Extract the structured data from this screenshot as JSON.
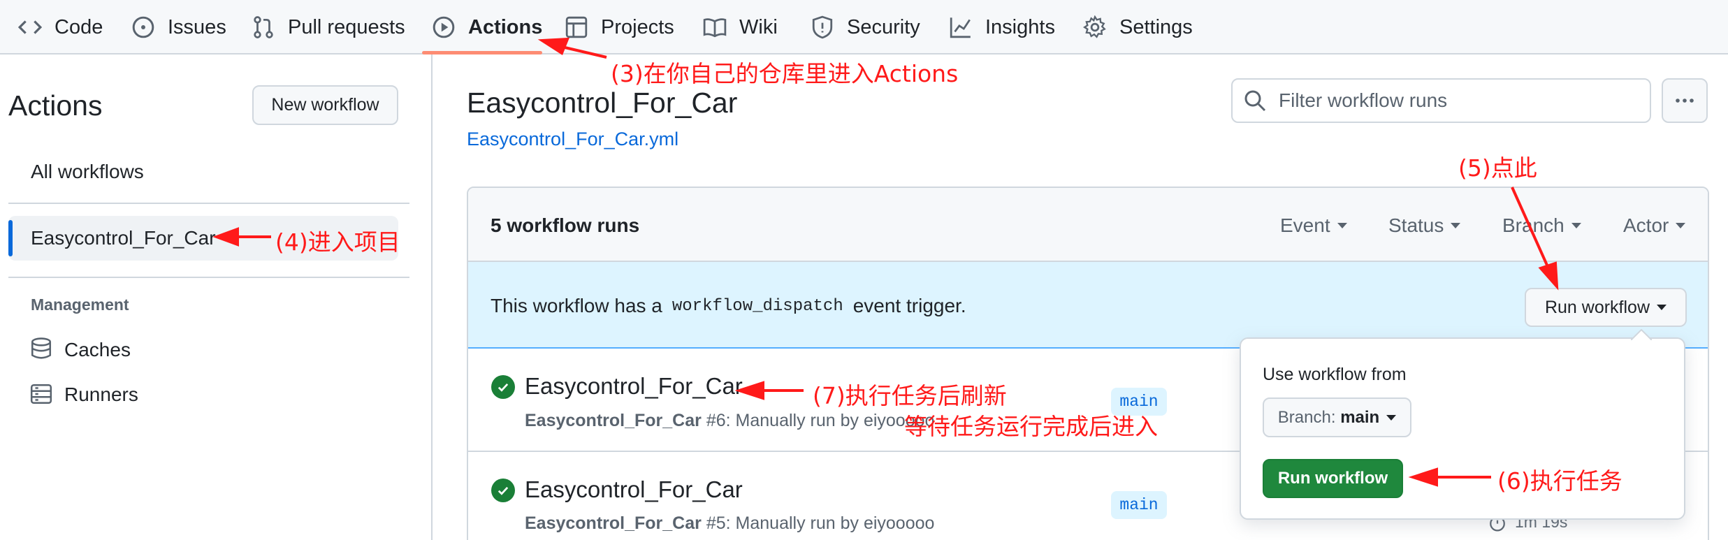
{
  "nav": {
    "tabs": [
      {
        "label": "Code",
        "icon": "code-icon"
      },
      {
        "label": "Issues",
        "icon": "issue-icon"
      },
      {
        "label": "Pull requests",
        "icon": "pull-request-icon"
      },
      {
        "label": "Actions",
        "icon": "play-icon",
        "active": true
      },
      {
        "label": "Projects",
        "icon": "table-icon"
      },
      {
        "label": "Wiki",
        "icon": "book-icon"
      },
      {
        "label": "Security",
        "icon": "shield-icon"
      },
      {
        "label": "Insights",
        "icon": "graph-icon"
      },
      {
        "label": "Settings",
        "icon": "gear-icon"
      }
    ]
  },
  "sidebar": {
    "title": "Actions",
    "new_workflow": "New workflow",
    "all_workflows": "All workflows",
    "selected_workflow": "Easycontrol_For_Car",
    "management_heading": "Management",
    "caches": "Caches",
    "runners": "Runners"
  },
  "main": {
    "workflow_title": "Easycontrol_For_Car",
    "workflow_file": "Easycontrol_For_Car.yml",
    "filter_placeholder": "Filter workflow runs",
    "runs_count": "5 workflow runs",
    "filters": {
      "event": "Event",
      "status": "Status",
      "branch": "Branch",
      "actor": "Actor"
    },
    "dispatch_prefix": "This workflow has a",
    "dispatch_code": "workflow_dispatch",
    "dispatch_suffix": "event trigger.",
    "run_workflow_button": "Run workflow",
    "runs": [
      {
        "title": "Easycontrol_For_Car",
        "workflow": "Easycontrol_For_Car",
        "meta": "#6: Manually run by eiyooooo",
        "branch": "main"
      },
      {
        "title": "Easycontrol_For_Car",
        "workflow": "Easycontrol_For_Car",
        "meta": "#5: Manually run by eiyooooo",
        "branch": "main",
        "duration": "1m 19s"
      }
    ],
    "popover": {
      "heading": "Use workflow from",
      "branch_label": "Branch:",
      "branch_value": "main",
      "run_button": "Run workflow"
    }
  },
  "annotations": {
    "a3": "(3)在你自己的仓库里进入Actions",
    "a4": "(4)进入项目",
    "a5": "(5)点此",
    "a6": "(6)执行任务",
    "a7_line1": "(7)执行任务后刷新",
    "a7_line2": "等待任务运行完成后进入"
  },
  "colors": {
    "accent_blue": "#0969da",
    "success_green": "#1f883d",
    "nav_underline": "#fd8c73",
    "annotation_red": "#ff1a1a",
    "dispatch_banner": "#ddf4ff"
  }
}
